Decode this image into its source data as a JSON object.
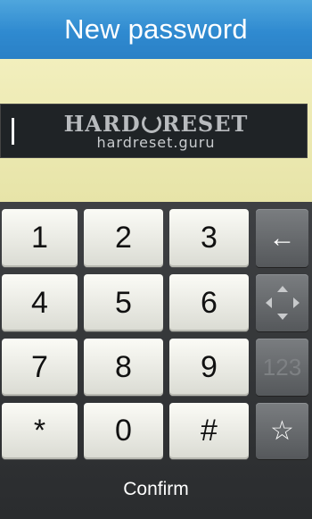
{
  "title": "New password",
  "field": {
    "value": ""
  },
  "watermark": {
    "brand_left": "HARD",
    "brand_right": "RESET",
    "url": "hardreset.guru"
  },
  "keys": [
    "1",
    "2",
    "3",
    "4",
    "5",
    "6",
    "7",
    "8",
    "9",
    "*",
    "0",
    "#"
  ],
  "side_keys": {
    "backspace": "←",
    "navigation_icon": "dpad-icon",
    "mode_label": "123",
    "symbol": "☆"
  },
  "confirm_label": "Confirm",
  "colors": {
    "titlebar": "#2f8ad0",
    "background": "#e9e7b2",
    "field": "#1f2326",
    "keypad": "#333537"
  }
}
